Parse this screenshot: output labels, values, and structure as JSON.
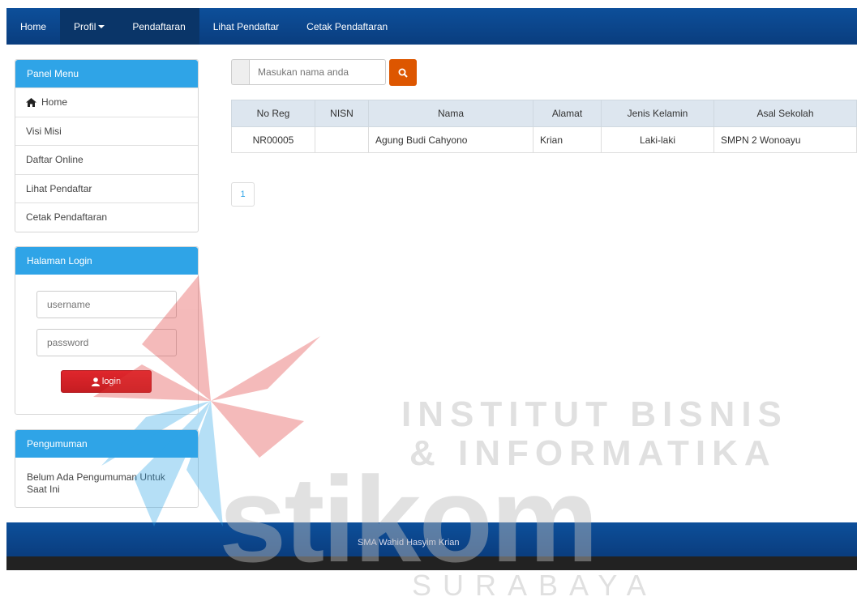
{
  "nav": {
    "items": [
      {
        "label": "Home",
        "active": true
      },
      {
        "label": "Profil",
        "active": true,
        "dropdown": true
      },
      {
        "label": "Pendaftaran",
        "active": true
      },
      {
        "label": "Lihat Pendaftar",
        "active": false
      },
      {
        "label": "Cetak Pendaftaran",
        "active": false
      }
    ]
  },
  "sidebar": {
    "panel_menu": {
      "title": "Panel Menu",
      "items": [
        {
          "label": "Home",
          "icon": "home-icon"
        },
        {
          "label": "Visi Misi"
        },
        {
          "label": "Daftar Online"
        },
        {
          "label": "Lihat Pendaftar"
        },
        {
          "label": "Cetak Pendaftaran"
        }
      ]
    },
    "login": {
      "title": "Halaman Login",
      "username_placeholder": "username",
      "password_placeholder": "password",
      "button_label": "login",
      "button_icon": "user-icon"
    },
    "announcement": {
      "title": "Pengumuman",
      "text": "Belum Ada Pengumuman Untuk Saat Ini"
    }
  },
  "search": {
    "placeholder": "Masukan nama anda",
    "button_icon": "search-icon"
  },
  "table": {
    "columns": [
      "No Reg",
      "NISN",
      "Nama",
      "Alamat",
      "Jenis Kelamin",
      "Asal Sekolah"
    ],
    "rows": [
      [
        "NR00005",
        "",
        "Agung Budi Cahyono",
        "Krian",
        "Laki-laki",
        "SMPN 2 Wonoayu"
      ]
    ]
  },
  "pagination": {
    "current": "1"
  },
  "footer": {
    "text": "SMA Wahid Hasyim Krian"
  },
  "watermark": {
    "line1": "INSTITUT BISNIS",
    "line2": "& INFORMATIKA",
    "brand": "stikom",
    "city": "SURABAYA"
  },
  "colors": {
    "nav_bg": "#0d4f9a",
    "panel_heading": "#2fa4e7",
    "login_button": "#d9242a",
    "search_button": "#dd5600"
  }
}
